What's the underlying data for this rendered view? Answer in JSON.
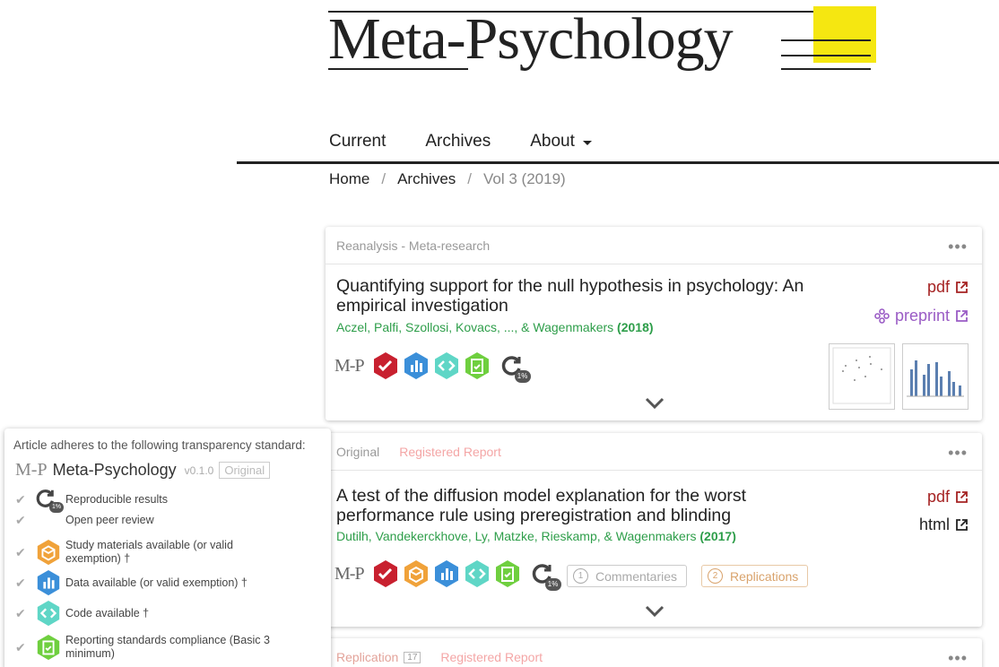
{
  "header": {
    "logo_text": "Meta-Psychology",
    "brand_color": "#f5e711"
  },
  "nav": {
    "items": [
      {
        "label": "Current"
      },
      {
        "label": "Archives"
      },
      {
        "label": "About"
      }
    ]
  },
  "breadcrumb": {
    "home": "Home",
    "archives": "Archives",
    "current": "Vol 3 (2019)"
  },
  "articles": [
    {
      "category": "Reanalysis - Meta-research",
      "title": "Quantifying support for the null hypothesis in psychology: An empirical investigation",
      "authors": "Aczel, Palfi, Szollosi, Kovacs, ..., & Wagenmakers",
      "year": "(2018)",
      "links": {
        "pdf": "pdf",
        "preprint": "preprint"
      },
      "mp_mark": "M-P",
      "repro_percent": "1%",
      "badges": [
        "peer-review-icon",
        "data-icon",
        "code-icon",
        "reporting-icon"
      ]
    },
    {
      "category": "Original",
      "tag": "Registered Report",
      "title": "A test of the diffusion model explanation for the worst performance rule using preregistration and blinding",
      "authors": "Dutilh, Vandekerckhove, Ly, Matzke, Rieskamp, & Wagenmakers",
      "year": "(2017)",
      "links": {
        "pdf": "pdf",
        "html": "html"
      },
      "mp_mark": "M-P",
      "repro_percent": "1%",
      "commentaries": {
        "label": "Commentaries",
        "count": "1"
      },
      "replications": {
        "label": "Replications",
        "count": "2"
      }
    },
    {
      "category": "Replication",
      "category_count": "17",
      "tag": "Registered Report"
    }
  ],
  "popup": {
    "heading": "Article adheres to the following transparency standard:",
    "mp_mark": "M-P",
    "standard_name": "Meta-Psychology",
    "version": "v0.1.0",
    "badge": "Original",
    "repro_percent": "1%",
    "rows": [
      {
        "label": "Reproducible results"
      },
      {
        "label": "Open peer review"
      },
      {
        "label": "Study materials available (or valid exemption) †"
      },
      {
        "label": "Data available (or valid exemption) †"
      },
      {
        "label": "Code available †"
      },
      {
        "label": "Reporting standards compliance  (Basic 3 minimum)"
      }
    ]
  },
  "colors": {
    "peer_review": "#c8202f",
    "materials": "#f0a23a",
    "data": "#3b8fd9",
    "code": "#5fd6c6",
    "reporting": "#6fcf3f",
    "author_green": "#2e9e4a",
    "pdf_red": "#a52222",
    "preprint_purple": "#9a5cc5"
  }
}
